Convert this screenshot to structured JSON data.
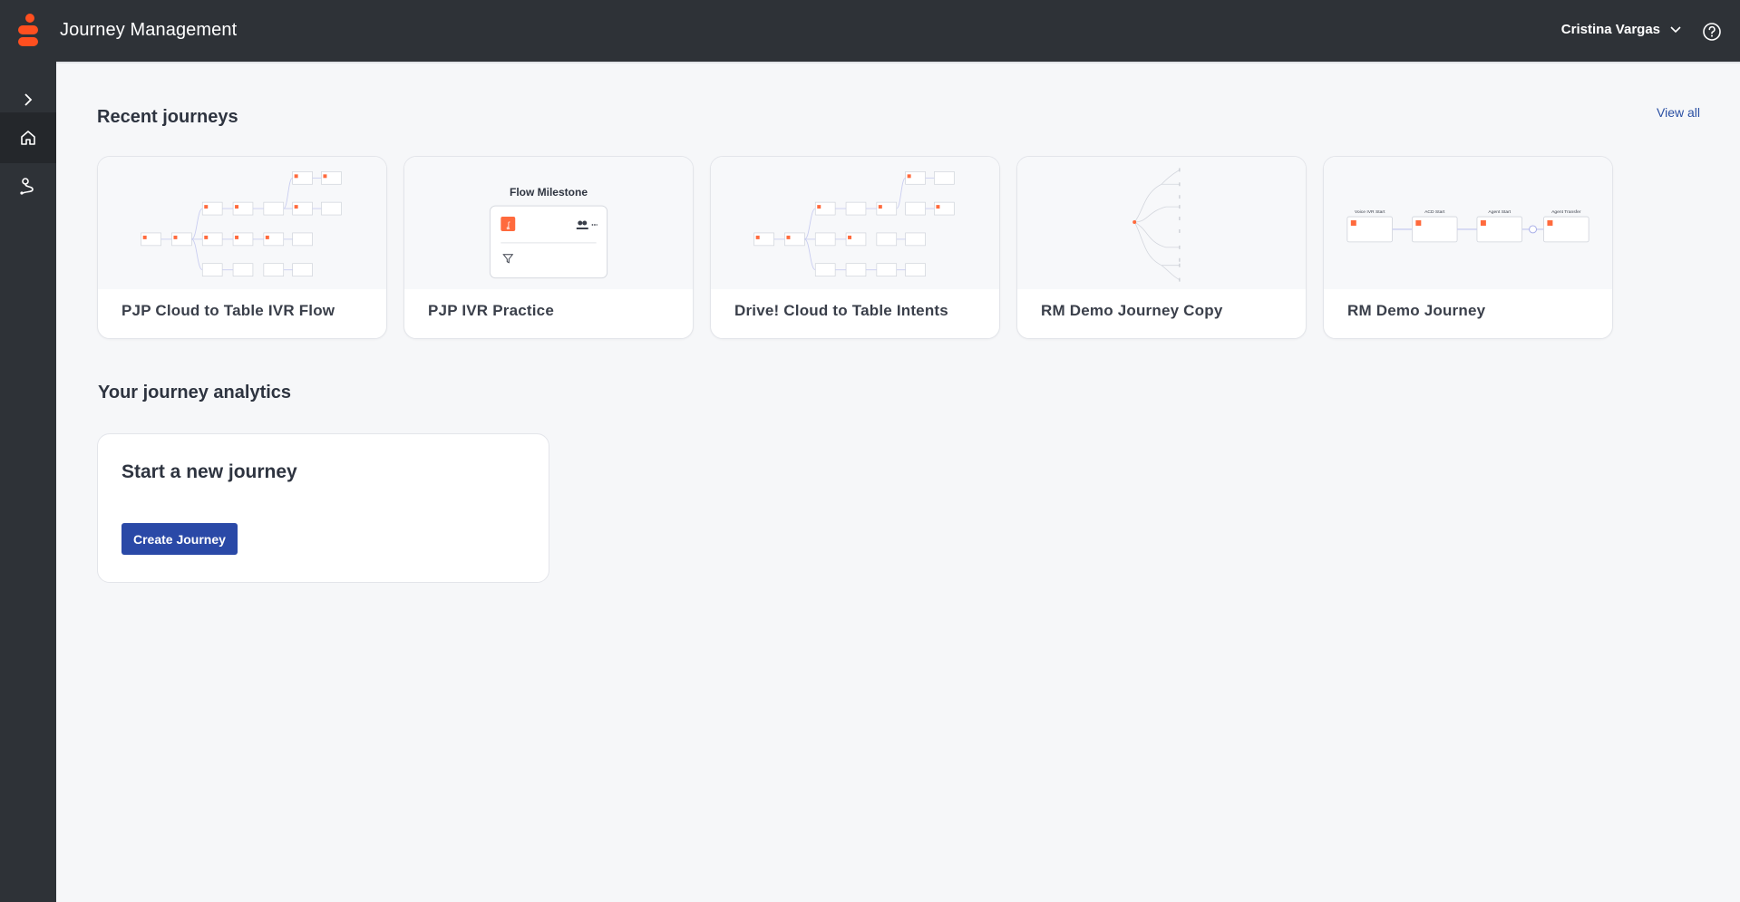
{
  "header": {
    "title": "Journey Management",
    "user_name": "Cristina Vargas",
    "brand_color": "#ff4f1f"
  },
  "sidebar": {
    "items": [
      {
        "icon": "chevron-right-icon"
      },
      {
        "icon": "home-icon"
      },
      {
        "icon": "journey-path-icon"
      }
    ]
  },
  "recent": {
    "title": "Recent journeys",
    "view_all": "View all",
    "cards": [
      {
        "name": "PJP Cloud to Table IVR Flow"
      },
      {
        "name": "PJP IVR Practice",
        "preview_label": "Flow Milestone"
      },
      {
        "name": "Drive! Cloud to Table Intents"
      },
      {
        "name": "RM Demo Journey Copy"
      },
      {
        "name": "RM Demo Journey",
        "preview_labels": [
          "Voice IVR Start",
          "ACD Start",
          "Agent Start",
          "Agent Transfer"
        ]
      }
    ]
  },
  "analytics": {
    "title": "Your journey analytics",
    "new_title": "Start a new journey",
    "create_label": "Create Journey"
  }
}
